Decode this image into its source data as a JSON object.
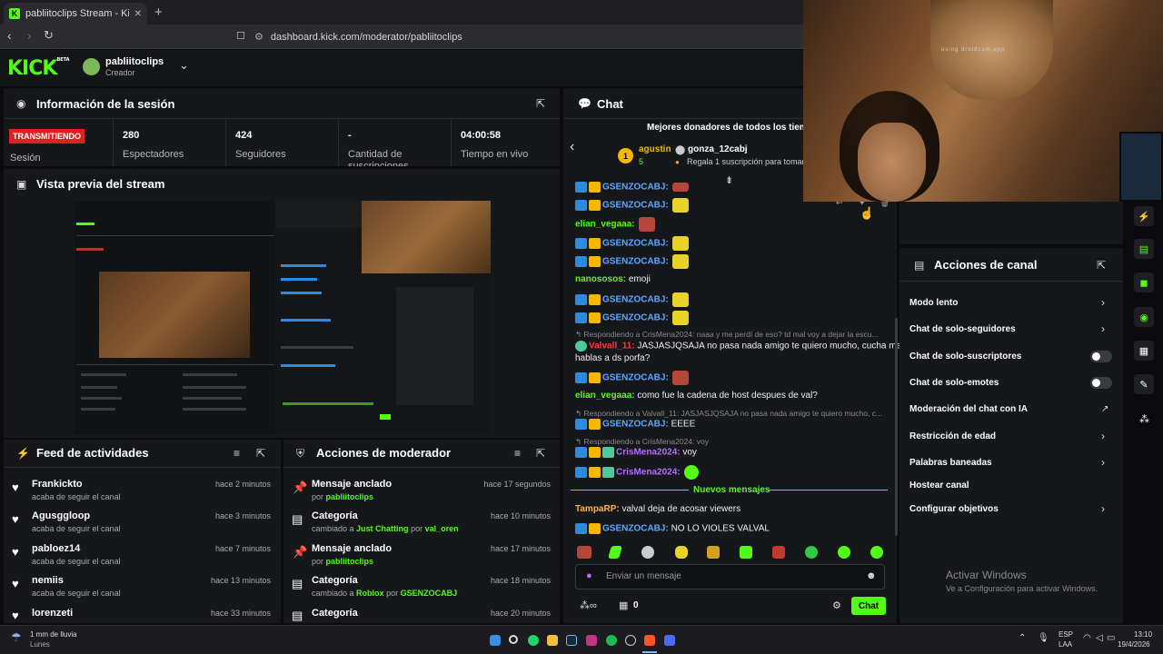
{
  "browser": {
    "tab_title": "pabliitoclips Stream - Kick Dashb",
    "new_tab": "+",
    "url": "dashboard.kick.com/moderator/pabliitoclips"
  },
  "header": {
    "logo": "KICK",
    "logo_beta": "BETA",
    "user_name": "pabliitoclips",
    "user_role": "Creador"
  },
  "session": {
    "title": "Información de la sesión",
    "status_badge": "TRANSMITIENDO",
    "status_label": "Sesión",
    "stats": [
      {
        "value": "280",
        "label": "Espectadores"
      },
      {
        "value": "424",
        "label": "Seguidores"
      },
      {
        "value": "-",
        "label": "Cantidad de suscripciones"
      },
      {
        "value": "04:00:58",
        "label": "Tiempo en vivo"
      }
    ]
  },
  "preview": {
    "title": "Vista previa del stream"
  },
  "activity": {
    "title": "Feed de actividades",
    "items": [
      {
        "name": "Frankickto",
        "sub": "acaba de seguir el canal",
        "time": "hace 2 minutos"
      },
      {
        "name": "Agusggloop",
        "sub": "acaba de seguir el canal",
        "time": "hace 3 minutos"
      },
      {
        "name": "pabloez14",
        "sub": "acaba de seguir el canal",
        "time": "hace 7 minutos"
      },
      {
        "name": "nemiis",
        "sub": "acaba de seguir el canal",
        "time": "hace 13 minutos"
      },
      {
        "name": "lorenzeti",
        "sub": "",
        "time": "hace 33 minutos"
      }
    ]
  },
  "mod_actions": {
    "title": "Acciones de moderador",
    "items": [
      {
        "title": "Mensaje anclado",
        "sub_prefix": "por",
        "sub_user": "pabliitoclips",
        "time": "hace 17 segundos",
        "icon": "pin-icon"
      },
      {
        "title": "Categoría",
        "sub_prefix": "cambiado a",
        "sub_cat": "Just Chatting",
        "sub_by": "por",
        "sub_user": "val_oren",
        "time": "hace 10 minutos",
        "icon": "category-icon"
      },
      {
        "title": "Mensaje anclado",
        "sub_prefix": "por",
        "sub_user": "pabliitoclips",
        "time": "hace 17 minutos",
        "icon": "pin-icon"
      },
      {
        "title": "Categoría",
        "sub_prefix": "cambiado a",
        "sub_cat": "Roblox",
        "sub_by": "por",
        "sub_user": "GSENZOCABJ",
        "time": "hace 18 minutos",
        "icon": "category-icon"
      },
      {
        "title": "Categoría",
        "time": "hace 20 minutos",
        "icon": "category-icon"
      }
    ]
  },
  "chat": {
    "title": "Chat",
    "donors_title": "Mejores donadores de todos los tiemp",
    "top_donor": "agustin",
    "top_donor_count": "5",
    "donor2": "gonza_12cabj",
    "donor2_sub": "Regala 1 suscripción para tomar l",
    "messages": {
      "m1_user": "GSENZOCABJ:",
      "m2_user": "GSENZOCABJ:",
      "m3_user": "elian_vegaaa:",
      "m4_user": "GSENZOCABJ:",
      "m5_user": "GSENZOCABJ:",
      "m6_user": "nanososos:",
      "m6_text": " emoji",
      "m7_user": "GSENZOCABJ:",
      "m8_user": "GSENZOCABJ:",
      "r9": "Respondiendo a CrisMena2024: naaa y me perdí de eso? td mal voy a dejar la escu...",
      "m9_user": "Valvall_11:",
      "m9_text": " JASJASJQSAJA no pasa nada amigo te quiero mucho, cucha me",
      "m9_text2": "hablas a ds porfa?",
      "m10_user": "GSENZOCABJ:",
      "m11_user": "elian_vegaaa:",
      "m11_text": " como fue la cadena de host despues de val?",
      "r12": "Respondiendo a Valvall_11: JASJASJQSAJA no pasa nada amigo te quiero mucho, c...",
      "m12_user": "GSENZOCABJ:",
      "m12_text": " EEEE",
      "r13": "Respondiendo a CrisMena2024: voy",
      "m13_user": "CrisMena2024:",
      "m13_text": " voy",
      "m14_user": "CrisMena2024:",
      "new_messages": "Nuevos mensajes",
      "m15_user": "TampaRP:",
      "m15_text": " valval deja de acosar viewers",
      "m16_user": "GSENZOCABJ:",
      "m16_text": " NO LO VIOLES VALVAL"
    },
    "input_placeholder": "Enviar un mensaje",
    "points": "0",
    "send_label": "Chat"
  },
  "channel_actions": {
    "title": "Acciones de canal",
    "items": [
      {
        "label": "Modo lento",
        "control": "chevron"
      },
      {
        "label": "Chat de solo-seguidores",
        "control": "chevron"
      },
      {
        "label": "Chat de solo-suscriptores",
        "control": "toggle"
      },
      {
        "label": "Chat de solo-emotes",
        "control": "toggle"
      },
      {
        "label": "Moderación del chat con IA",
        "control": "external"
      },
      {
        "label": "Restricción de edad",
        "control": "chevron"
      },
      {
        "label": "Palabras baneadas",
        "control": "chevron"
      },
      {
        "label": "Hostear canal",
        "control": "none"
      },
      {
        "label": "Configurar objetivos",
        "control": "chevron"
      }
    ]
  },
  "windows_watermark": {
    "line1": "Activar Windows",
    "line2": "Ve a Configuración para activar Windows."
  },
  "webcam": {
    "overlay_text": "using droidcam.app"
  },
  "taskbar": {
    "weather_line1": "1 mm de lluvia",
    "weather_line2": "Lunes",
    "lang_line1": "ESP",
    "lang_line2": "LAA",
    "time": "13:10",
    "date": "19/4/2026"
  },
  "colors": {
    "kick_green": "#53fc18",
    "live_red": "#e02020",
    "mod_blue": "#5aa8ff"
  }
}
